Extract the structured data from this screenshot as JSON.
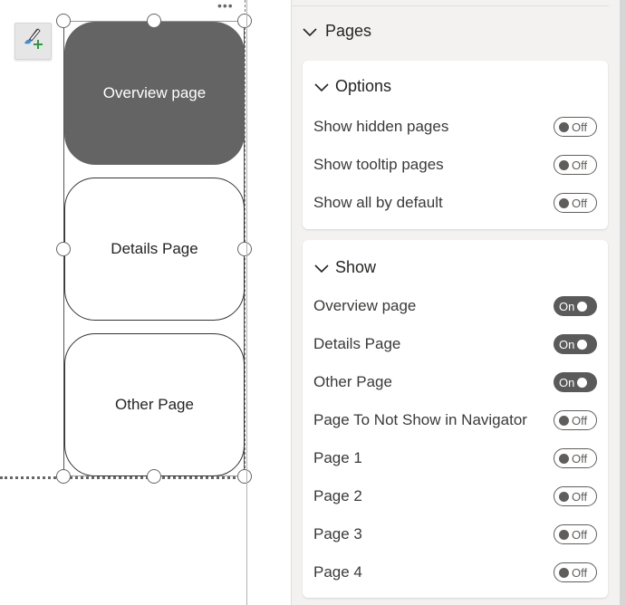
{
  "canvas": {
    "more_options": "•••",
    "buttons": [
      {
        "label": "Overview page",
        "state": "selected"
      },
      {
        "label": "Details Page",
        "state": "default"
      },
      {
        "label": "Other Page",
        "state": "default"
      }
    ]
  },
  "format_pane": {
    "section_title": "Pages",
    "options_card": {
      "title": "Options",
      "rows": [
        {
          "label": "Show hidden pages",
          "toggle": "Off"
        },
        {
          "label": "Show tooltip pages",
          "toggle": "Off"
        },
        {
          "label": "Show all by default",
          "toggle": "Off"
        }
      ]
    },
    "show_card": {
      "title": "Show",
      "rows": [
        {
          "label": "Overview page",
          "toggle": "On"
        },
        {
          "label": "Details Page",
          "toggle": "On"
        },
        {
          "label": "Other Page",
          "toggle": "On"
        },
        {
          "label": "Page To Not Show in Navigator",
          "toggle": "Off"
        },
        {
          "label": "Page 1",
          "toggle": "Off"
        },
        {
          "label": "Page 2",
          "toggle": "Off"
        },
        {
          "label": "Page 3",
          "toggle": "Off"
        },
        {
          "label": "Page 4",
          "toggle": "Off"
        }
      ]
    }
  },
  "colors": {
    "active_button": "#646464",
    "toggle_on": "#5a5a5a",
    "pane_bg": "#f3f2f1"
  }
}
